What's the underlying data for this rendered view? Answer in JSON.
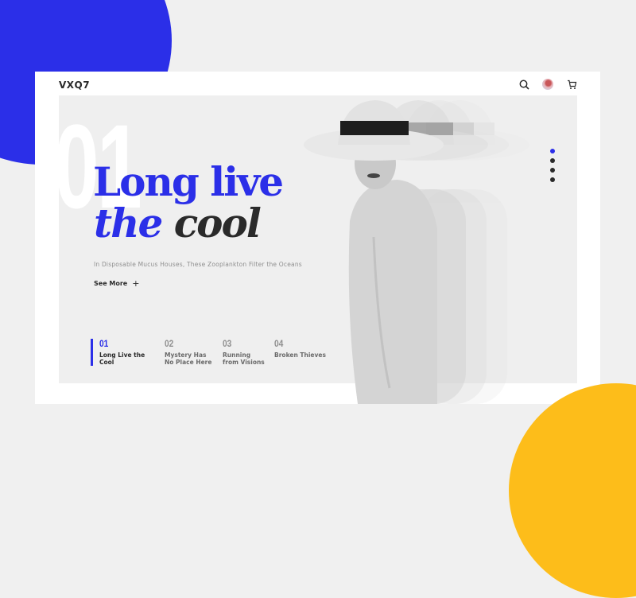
{
  "brand": {
    "logo": "VXQ7"
  },
  "header": {
    "icons": [
      "search-icon",
      "avatar",
      "cart-icon"
    ]
  },
  "hero": {
    "slide_number": "01",
    "title_line1": "Long live",
    "title_line2_a": "the",
    "title_line2_b": "cool",
    "subtitle": "In Disposable Mucus Houses, These Zooplankton Filter the Oceans",
    "see_more": "See More",
    "see_more_icon": "+"
  },
  "slides": [
    {
      "num": "01",
      "label": "Long Live the Cool",
      "active": true
    },
    {
      "num": "02",
      "label": "Mystery Has No Place Here",
      "active": false
    },
    {
      "num": "03",
      "label": "Running from Visions",
      "active": false
    },
    {
      "num": "04",
      "label": "Broken Thieves",
      "active": false
    }
  ],
  "pagination": {
    "count": 4,
    "active_index": 0
  },
  "colors": {
    "accent": "#2b2fe8",
    "yellow": "#fdbd1a",
    "text": "#2a2a2a",
    "panel": "#efefef"
  }
}
